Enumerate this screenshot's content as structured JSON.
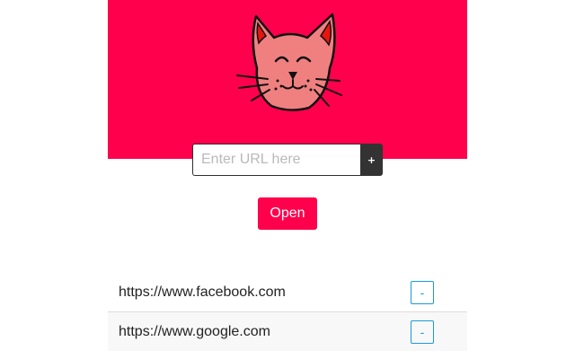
{
  "theme": {
    "accent_color": "#ff004c",
    "add_button_color": "#333333",
    "remove_button_color": "#1a9bd6"
  },
  "header": {
    "logo_icon": "cat-face-icon"
  },
  "url_form": {
    "input_value": "",
    "input_placeholder": "Enter URL here",
    "add_label": "+"
  },
  "open_button": {
    "label": "Open"
  },
  "url_list": {
    "items": [
      {
        "url": "https://www.facebook.com",
        "remove_label": "-"
      },
      {
        "url": "https://www.google.com",
        "remove_label": "-"
      }
    ]
  }
}
